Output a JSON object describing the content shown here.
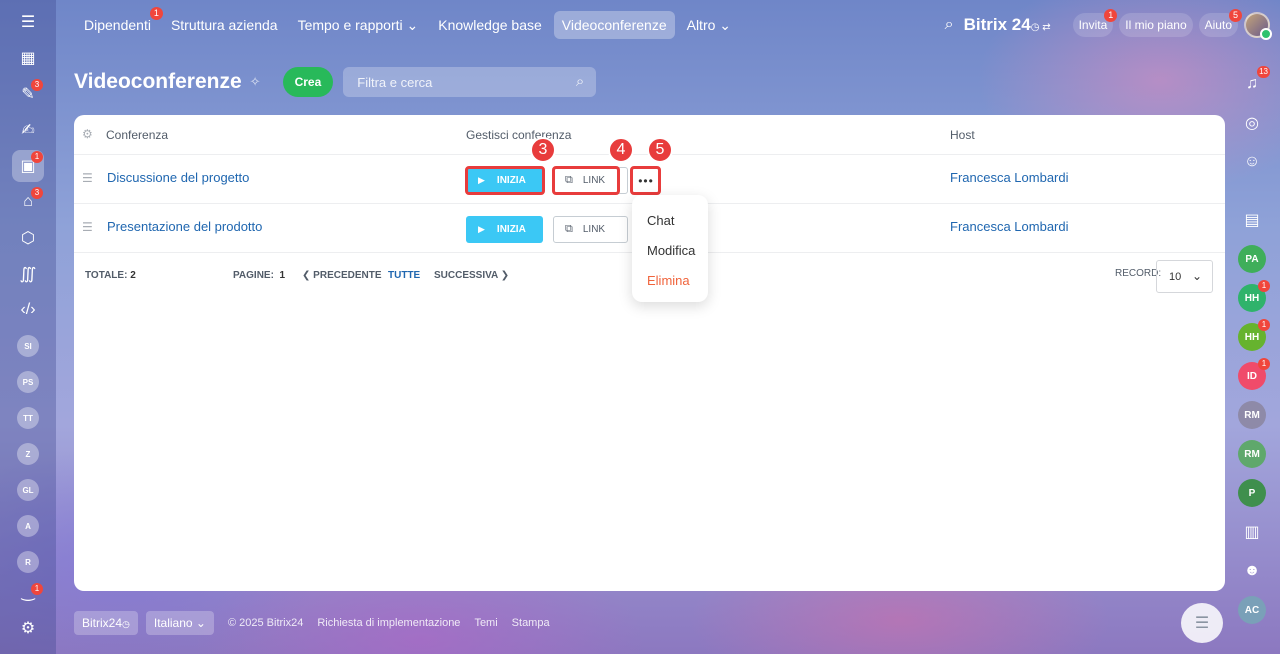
{
  "topnav": {
    "items": [
      {
        "label": "Dipendenti",
        "badge": "1"
      },
      {
        "label": "Struttura azienda"
      },
      {
        "label": "Tempo e rapporti ⌄"
      },
      {
        "label": "Knowledge base"
      },
      {
        "label": "Videoconferenze",
        "active": true
      },
      {
        "label": "Altro ⌄"
      }
    ],
    "brand": "Bitrix 24",
    "invite": {
      "label": "Invita",
      "badge": "1"
    },
    "plan": "Il mio piano",
    "help": {
      "label": "Aiuto",
      "badge": "5"
    }
  },
  "left_rail": {
    "badges": {
      "tasks": "3",
      "video": "1",
      "robot": "3",
      "bottom": "1"
    },
    "avatars": [
      "SI",
      "PS",
      "TT",
      "Z",
      "GL",
      "A",
      "R"
    ]
  },
  "right_rail": {
    "bell_badge": "13",
    "avatars": [
      {
        "label": "PA",
        "color": "#3fae5a"
      },
      {
        "label": "HH",
        "color": "#2fb36b",
        "badge": "1"
      },
      {
        "label": "HH",
        "color": "#66b32e",
        "badge": "1"
      },
      {
        "label": "ID",
        "color": "#f04b6a",
        "badge": "1"
      },
      {
        "label": "RM",
        "color": "#8e8aa8"
      },
      {
        "label": "RM",
        "color": "#5fa86c"
      },
      {
        "label": "P",
        "color": "#3f8f4d"
      },
      {
        "label": "AC",
        "color": "#7aa0b8"
      }
    ]
  },
  "page": {
    "title": "Videoconferenze",
    "create_label": "Crea",
    "filter_placeholder": "Filtra e cerca"
  },
  "table": {
    "headers": {
      "conference": "Conferenza",
      "manage": "Gestisci conferenza",
      "host": "Host"
    },
    "rows": [
      {
        "name": "Discussione del progetto",
        "start": "INIZIA",
        "link": "LINK",
        "host": "Francesca Lombardi"
      },
      {
        "name": "Presentazione del prodotto",
        "start": "INIZIA",
        "link": "LINK",
        "host": "Francesca Lombardi"
      }
    ],
    "footer": {
      "total_label": "TOTALE:",
      "total": "2",
      "pages_label": "PAGINE:",
      "page": "1",
      "prev": "PRECEDENTE",
      "all": "TUTTE",
      "next": "SUCCESSIVA",
      "record_label": "RECORD:",
      "record_value": "10"
    }
  },
  "callouts": [
    "3",
    "4",
    "5"
  ],
  "dropdown": {
    "chat": "Chat",
    "edit": "Modifica",
    "delete": "Elimina"
  },
  "bottom": {
    "brand": "Bitrix24",
    "language": "Italiano",
    "copyright": "© 2025 Bitrix24",
    "request": "Richiesta di implementazione",
    "themes": "Temi",
    "print": "Stampa"
  }
}
